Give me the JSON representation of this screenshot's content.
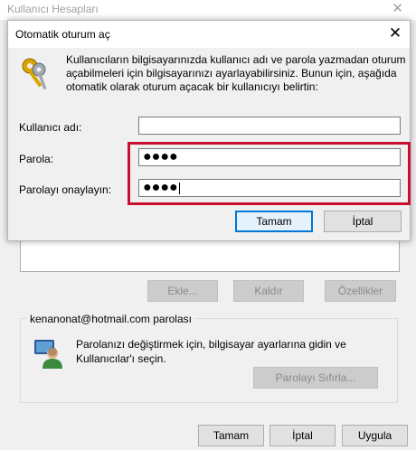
{
  "background_window": {
    "title": "Kullanıcı Hesapları",
    "close_glyph": "✕",
    "buttons": {
      "add": "Ekle...",
      "remove": "Kaldır",
      "properties": "Özellikler"
    },
    "password_group": {
      "label": "kenanonat@hotmail.com parolası",
      "text": "Parolanızı değiştirmek için, bilgisayar ayarlarına gidin ve Kullanıcılar'ı seçin.",
      "reset_button": "Parolayı Sıfırla..."
    },
    "footer": {
      "ok": "Tamam",
      "cancel": "İptal",
      "apply": "Uygula"
    }
  },
  "dialog": {
    "title": "Otomatik oturum aç",
    "close_glyph": "✕",
    "description": "Kullanıcıların bilgisayarınızda kullanıcı adı ve parola yazmadan oturum açabilmeleri için bilgisayarınızı ayarlayabilirsiniz. Bunun için, aşağıda otomatik olarak oturum açacak bir kullanıcıyı belirtin:",
    "fields": {
      "username": {
        "label": "Kullanıcı adı:",
        "value": ""
      },
      "password": {
        "label": "Parola:",
        "value": "●●●●"
      },
      "confirm": {
        "label": "Parolayı onaylayın:",
        "value": "●●●●"
      }
    },
    "buttons": {
      "ok": "Tamam",
      "cancel": "İptal"
    }
  },
  "colors": {
    "highlight": "#c8102e",
    "focus_border": "#0078d7"
  },
  "icons": [
    "keys-icon",
    "user-icon",
    "close-icon"
  ]
}
